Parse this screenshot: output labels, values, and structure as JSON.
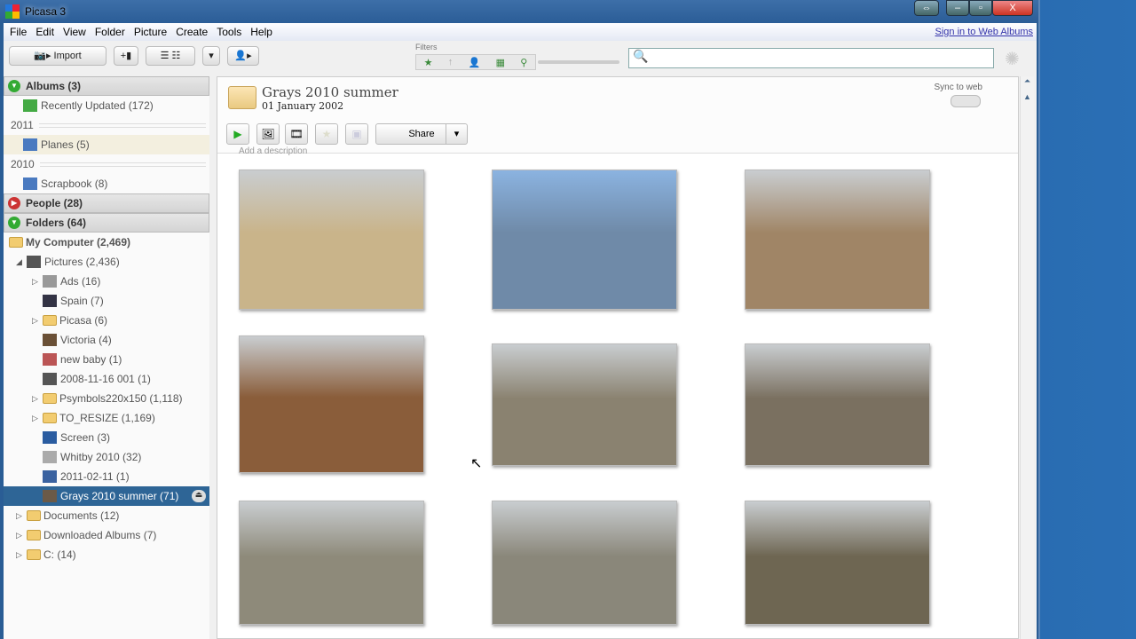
{
  "window": {
    "title": "Picasa 3"
  },
  "menu": [
    "File",
    "Edit",
    "View",
    "Folder",
    "Picture",
    "Create",
    "Tools",
    "Help"
  ],
  "sign_in": "Sign in to Web Albums",
  "toolbar": {
    "import": "Import",
    "filters_label": "Filters",
    "search_placeholder": ""
  },
  "sidebar": {
    "albums": "Albums (3)",
    "recently_updated": "Recently Updated (172)",
    "year2011": "2011",
    "planes": "Planes (5)",
    "year2010": "2010",
    "scrapbook": "Scrapbook (8)",
    "people": "People (28)",
    "folders": "Folders (64)",
    "my_computer": "My Computer (2,469)",
    "pictures": "Pictures (2,436)",
    "items": [
      {
        "label": "Ads (16)",
        "expand": true,
        "color": "#999"
      },
      {
        "label": "Spain (7)",
        "expand": false,
        "color": "#334"
      },
      {
        "label": "Picasa (6)",
        "expand": true,
        "folder": true
      },
      {
        "label": "Victoria (4)",
        "expand": false,
        "color": "#6a5036"
      },
      {
        "label": "new baby (1)",
        "expand": false,
        "color": "#b55"
      },
      {
        "label": "2008-11-16 001 (1)",
        "expand": false,
        "color": "#555"
      },
      {
        "label": "Psymbols220x150 (1,118)",
        "expand": true,
        "folder": true
      },
      {
        "label": "TO_RESIZE (1,169)",
        "expand": true,
        "folder": true
      },
      {
        "label": "Screen (3)",
        "expand": false,
        "color": "#2a5ca0"
      },
      {
        "label": "Whitby 2010 (32)",
        "expand": false,
        "color": "#aaa"
      },
      {
        "label": "2011-02-11 (1)",
        "expand": false,
        "color": "#3a62a0"
      },
      {
        "label": "Grays 2010 summer (71)",
        "expand": false,
        "color": "#6b5a48",
        "selected": true
      }
    ],
    "top": [
      {
        "label": "Documents (12)"
      },
      {
        "label": "Downloaded Albums (7)"
      },
      {
        "label": "C: (14)"
      }
    ]
  },
  "folder": {
    "title": "Grays 2010 summer",
    "date": "01 January 2002",
    "sync": "Sync to web",
    "share": "Share",
    "description_placeholder": "Add a description"
  },
  "photos": [
    "#c9b48a",
    "#6f8aa8",
    "#a08566",
    "#8a5d3a",
    "#8a8270",
    "#7a7060",
    "#8e8a7a",
    "#8a877a",
    "#6e6652"
  ]
}
